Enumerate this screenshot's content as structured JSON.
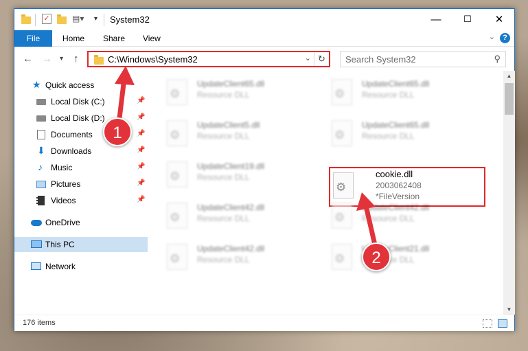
{
  "window": {
    "title": "System32",
    "controls": {
      "minimize": "—",
      "maximize": "☐",
      "close": "✕"
    }
  },
  "ribbon": {
    "tabs": [
      "File",
      "Home",
      "Share",
      "View"
    ],
    "help": "?"
  },
  "address": {
    "path": "C:\\Windows\\System32",
    "search_placeholder": "Search System32"
  },
  "sidebar": {
    "items": [
      {
        "label": "Quick access",
        "icon": "star-icon",
        "pinned": false
      },
      {
        "label": "Local Disk (C:)",
        "icon": "drive-icon",
        "pinned": true
      },
      {
        "label": "Local Disk (D:)",
        "icon": "drive-icon",
        "pinned": true
      },
      {
        "label": "Documents",
        "icon": "documents-icon",
        "pinned": true
      },
      {
        "label": "Downloads",
        "icon": "downloads-icon",
        "pinned": true
      },
      {
        "label": "Music",
        "icon": "music-icon",
        "pinned": true
      },
      {
        "label": "Pictures",
        "icon": "pictures-icon",
        "pinned": true
      },
      {
        "label": "Videos",
        "icon": "videos-icon",
        "pinned": true
      },
      {
        "label": "OneDrive",
        "icon": "onedrive-icon",
        "pinned": false
      },
      {
        "label": "This PC",
        "icon": "pc-icon",
        "pinned": false,
        "selected": true
      },
      {
        "label": "Network",
        "icon": "network-icon",
        "pinned": false
      }
    ]
  },
  "files": [
    {
      "name": "UpdateClient65.dll",
      "type": "Resource DLL"
    },
    {
      "name": "UpdateClient65.dll",
      "type": "Resource DLL"
    },
    {
      "name": "UpdateClient5.dll",
      "type": "Resource DLL"
    },
    {
      "name": "UpdateClient65.dll",
      "type": "Resource DLL"
    },
    {
      "name": "UpdateClient19.dll",
      "type": "Resource DLL"
    },
    {
      "name": "UpdateClient42.dll",
      "type": "Resource DLL"
    },
    {
      "name": "UpdateClient42.dll",
      "type": "Resource DLL"
    },
    {
      "name": "UpdateClient42.dll",
      "type": "Resource DLL"
    },
    {
      "name": "UpdateClient21.dll",
      "type": "Resource DLL"
    }
  ],
  "highlighted_file": {
    "name": "cookie.dll",
    "version": "2003062408",
    "description": "FileVersion"
  },
  "status": {
    "item_count": "176 items"
  },
  "annotations": {
    "step1": "1",
    "step2": "2"
  },
  "colors": {
    "accent": "#1979ca",
    "annotation_red": "#e2333a",
    "selection": "#cce0f4"
  }
}
